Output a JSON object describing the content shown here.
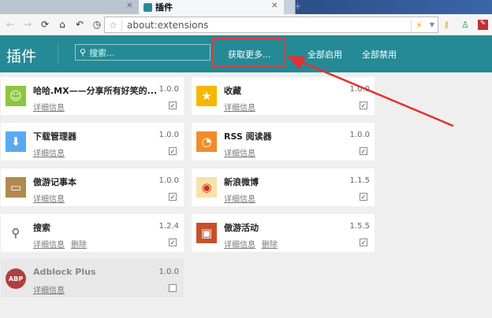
{
  "browser": {
    "active_tab": "插件",
    "url": "about:extensions"
  },
  "header": {
    "title": "插件",
    "search_placeholder": "搜索...",
    "get_more": "获取更多...",
    "enable_all": "全部启用",
    "disable_all": "全部禁用"
  },
  "labels": {
    "details": "详细信息",
    "remove": "删除"
  },
  "accent": "#268a96",
  "extensions": [
    {
      "name": "哈哈.MX——分享所有好笑的...",
      "version": "1.0.0",
      "icon": "laugh-face",
      "color": "#8cc63f",
      "enabled": true
    },
    {
      "name": "收藏",
      "version": "1.0.0",
      "icon": "star",
      "color": "#f5b800",
      "enabled": true
    },
    {
      "name": "下载管理器",
      "version": "1.0.0",
      "icon": "download-arrow",
      "color": "#5aa9ef",
      "enabled": true
    },
    {
      "name": "RSS 阅读器",
      "version": "1.0.0",
      "icon": "rss",
      "color": "#f28c28",
      "enabled": true
    },
    {
      "name": "傲游记事本",
      "version": "1.0.0",
      "icon": "notepad",
      "color": "#b08a50",
      "enabled": true
    },
    {
      "name": "新浪微博",
      "version": "1.1.5",
      "icon": "weibo",
      "color": "#f7e3a8",
      "enabled": true
    },
    {
      "name": "搜索",
      "version": "1.2.4",
      "icon": "magnifier",
      "color": "#ffffff",
      "enabled": true,
      "removable": true
    },
    {
      "name": "傲游活动",
      "version": "1.5.5",
      "icon": "gift",
      "color": "#c8502a",
      "enabled": true,
      "removable": true
    },
    {
      "name": "Adblock Plus",
      "version": "1.0.0",
      "icon": "abp-stop-sign",
      "color": "#b04040",
      "enabled": false
    }
  ]
}
